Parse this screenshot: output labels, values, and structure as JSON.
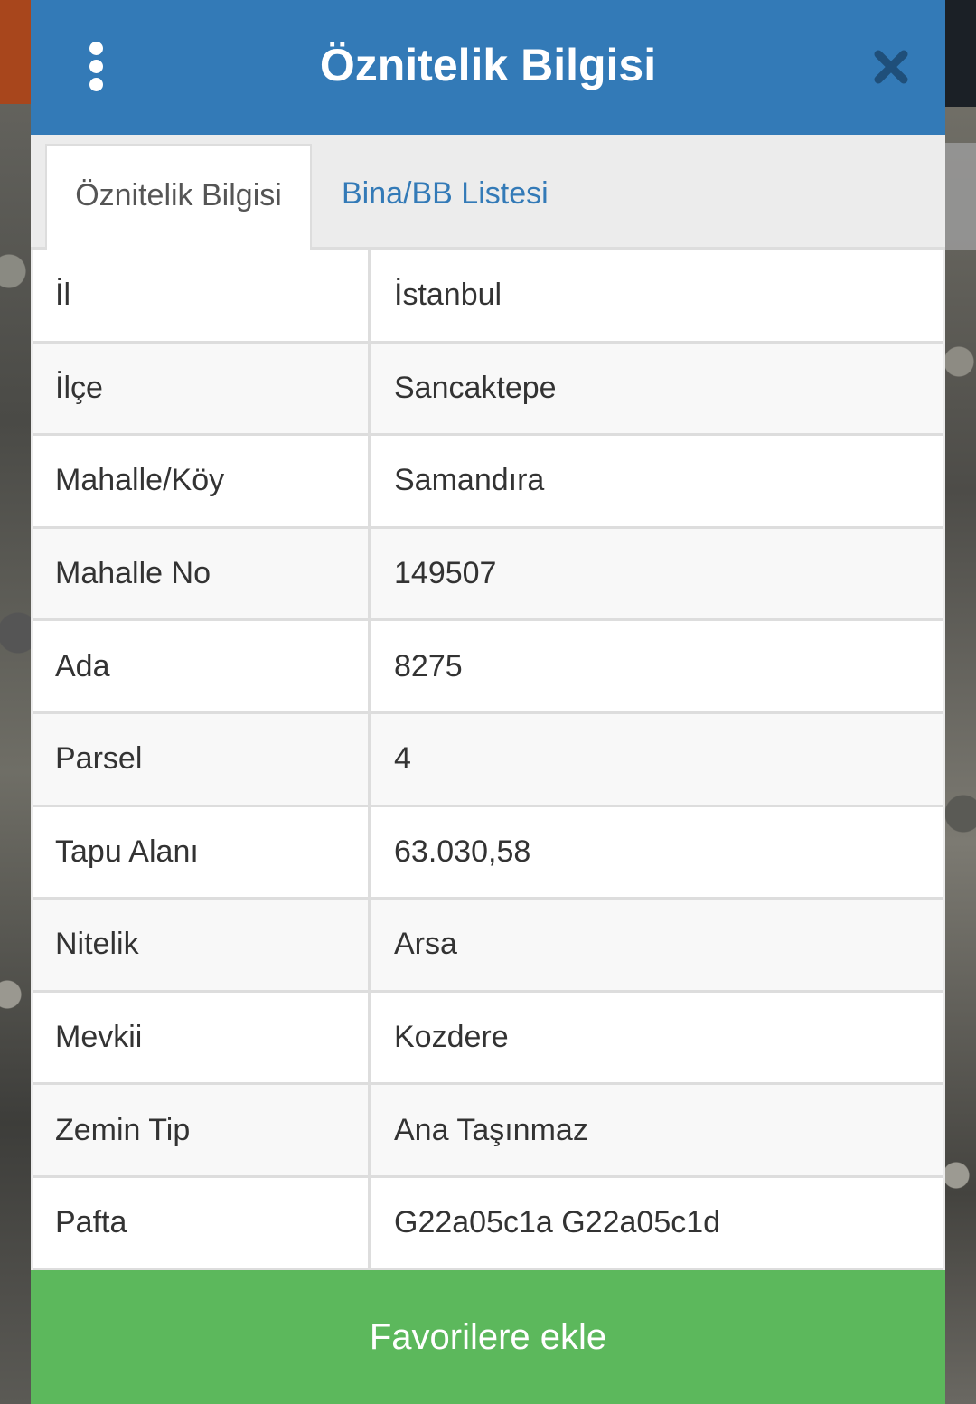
{
  "header": {
    "title": "Öznitelik Bilgisi",
    "menu_icon": "more-vertical-icon",
    "close_icon": "close-icon"
  },
  "tabs": [
    {
      "label": "Öznitelik Bilgisi",
      "active": true
    },
    {
      "label": "Bina/BB Listesi",
      "active": false
    }
  ],
  "attributes": [
    {
      "label": "İl",
      "value": "İstanbul"
    },
    {
      "label": "İlçe",
      "value": "Sancaktepe"
    },
    {
      "label": "Mahalle/Köy",
      "value": "Samandıra"
    },
    {
      "label": "Mahalle No",
      "value": "149507"
    },
    {
      "label": "Ada",
      "value": "8275"
    },
    {
      "label": "Parsel",
      "value": "4"
    },
    {
      "label": "Tapu Alanı",
      "value": "63.030,58"
    },
    {
      "label": "Nitelik",
      "value": "Arsa"
    },
    {
      "label": "Mevkii",
      "value": "Kozdere"
    },
    {
      "label": "Zemin Tip",
      "value": "Ana Taşınmaz"
    },
    {
      "label": "Pafta",
      "value": "G22a05c1a G22a05c1d"
    }
  ],
  "footer": {
    "favorite_label": "Favorilere ekle"
  },
  "colors": {
    "header": "#337ab7",
    "tab_link": "#337ab7",
    "favorite_button": "#5cb85c"
  }
}
